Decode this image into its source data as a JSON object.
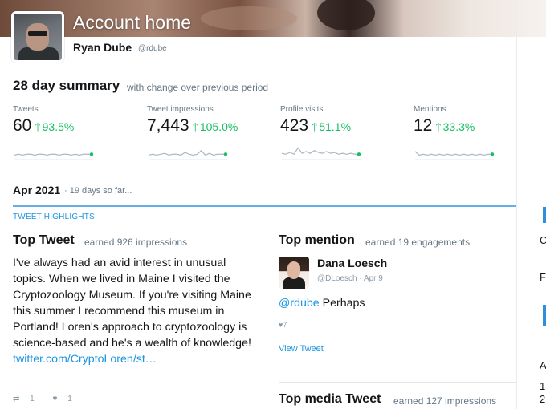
{
  "header": {
    "title": "Account home",
    "user_name": "Ryan Dube",
    "user_handle": "@rdube"
  },
  "summary": {
    "title": "28 day summary",
    "subtitle": "with change over previous period",
    "metrics": [
      {
        "label": "Tweets",
        "value": "60",
        "change": "93.5%",
        "spark": [
          4,
          5,
          4,
          5,
          5,
          4,
          5,
          5,
          4,
          5,
          5,
          4,
          5,
          5,
          4,
          5,
          4,
          5,
          5,
          5
        ]
      },
      {
        "label": "Tweet impressions",
        "value": "7,443",
        "change": "105.0%",
        "spark": [
          4,
          5,
          4,
          5,
          6,
          4,
          5,
          5,
          4,
          7,
          5,
          4,
          5,
          9,
          4,
          6,
          4,
          5,
          5,
          5
        ]
      },
      {
        "label": "Profile visits",
        "value": "423",
        "change": "51.1%",
        "spark": [
          6,
          5,
          7,
          5,
          12,
          6,
          8,
          6,
          9,
          7,
          6,
          8,
          6,
          7,
          5,
          6,
          5,
          6,
          5,
          5
        ]
      },
      {
        "label": "Mentions",
        "value": "12",
        "change": "33.3%",
        "spark": [
          8,
          4,
          5,
          4,
          5,
          4,
          5,
          4,
          5,
          4,
          5,
          4,
          5,
          4,
          5,
          4,
          5,
          4,
          5,
          5
        ]
      }
    ],
    "arrow_glyph": "🡑",
    "accent_color": "#17bf63"
  },
  "period": {
    "title": "Apr 2021",
    "subtitle": "· 19 days so far..."
  },
  "highlights": {
    "label": "TWEET HIGHLIGHTS",
    "top_tweet": {
      "title": "Top Tweet",
      "subtitle": "earned 926 impressions",
      "text": "I've always had an avid interest in unusual topics. When we lived in Maine I visited the Cryptozoology Museum. If you're visiting Maine this summer I recommend this museum in Portland! Loren's approach to cryptozoology is science-based and he's a wealth of knowledge!",
      "link": "twitter.com/CryptoLoren/st…",
      "retweets": "1",
      "likes": "1"
    },
    "top_mention": {
      "title": "Top mention",
      "subtitle": "earned 19 engagements",
      "name": "Dana Loesch",
      "handle": "@DLoesch · Apr 9",
      "mention_handle": "@rdube",
      "mention_text": "Perhaps",
      "likes": "7",
      "view_tweet": "View Tweet"
    },
    "top_media": {
      "title": "Top media Tweet",
      "subtitle": "earned 127 impressions"
    }
  },
  "sidebar_partial": {
    "glyphs": [
      "C",
      "F",
      "A",
      "1",
      "2"
    ]
  }
}
